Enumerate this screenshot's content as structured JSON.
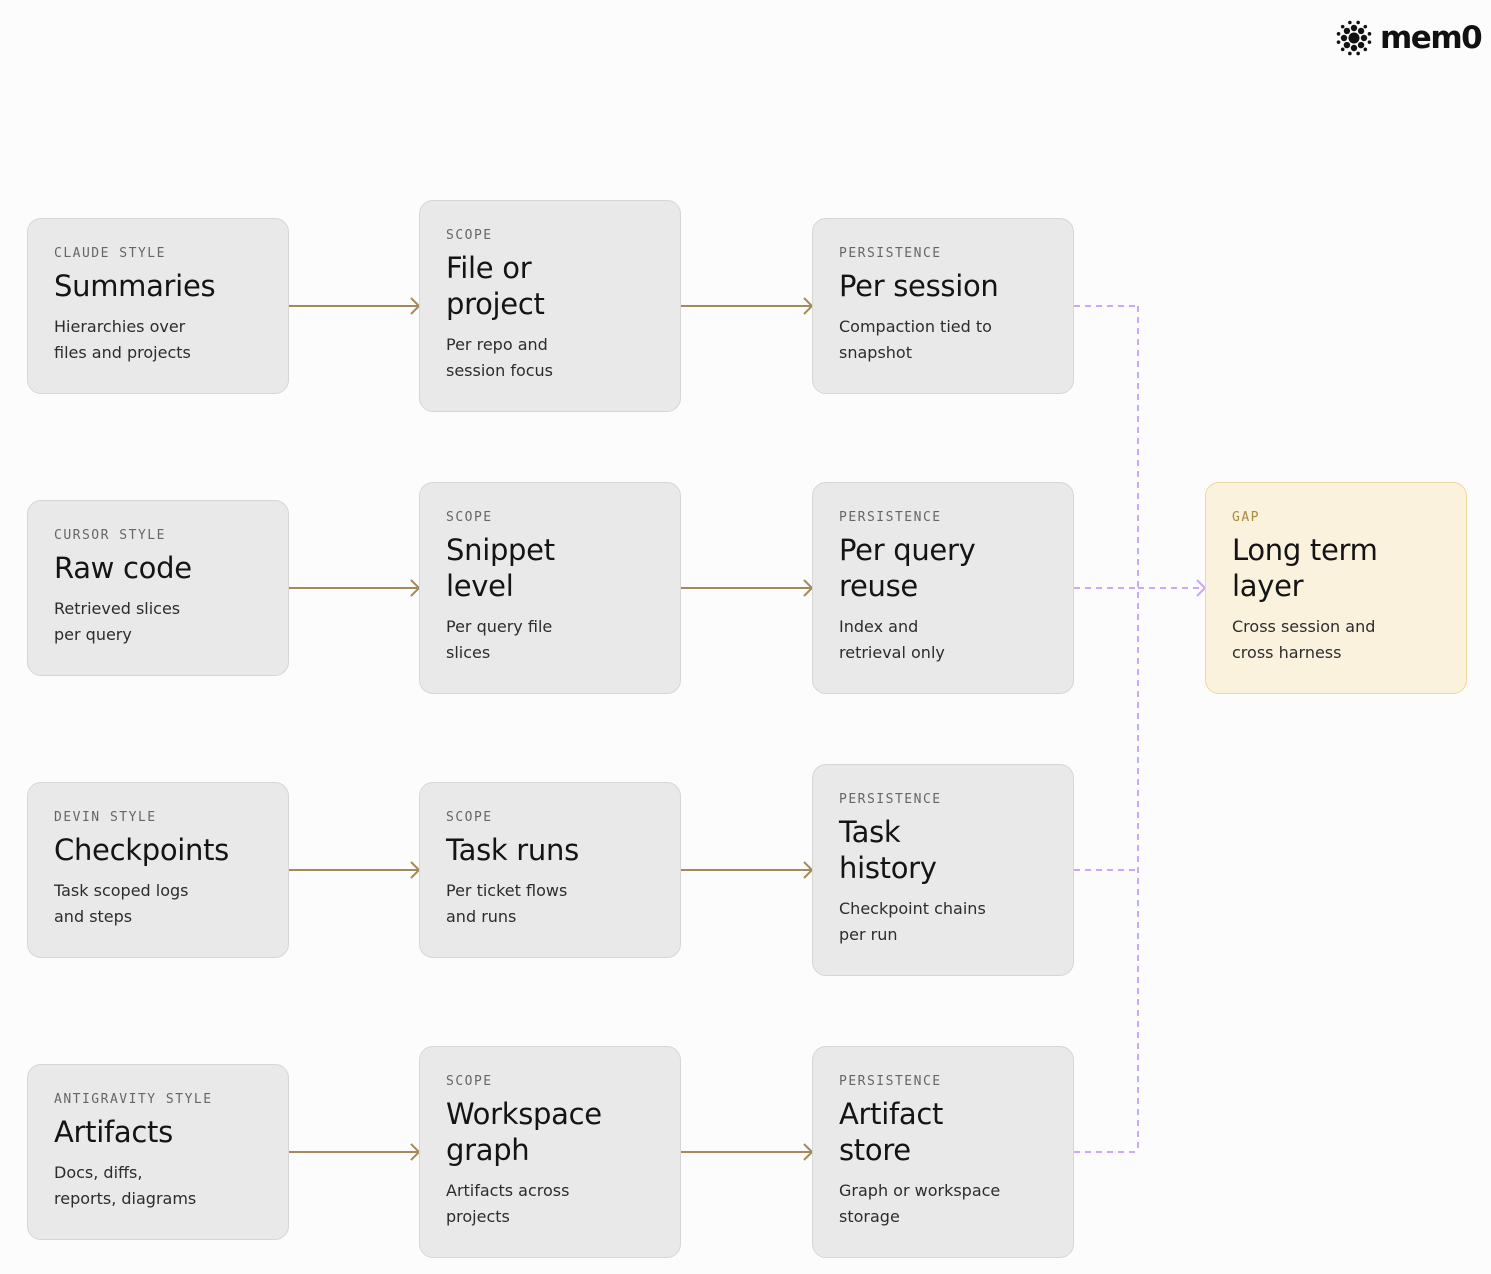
{
  "brand": {
    "wordmark": "mem0"
  },
  "colors": {
    "arrow": "#a48a5a",
    "dashed": "#c9a9f5",
    "card_bg": "#e9e9e9",
    "gap_bg": "#fbf2de",
    "gap_border": "#f1d89a"
  },
  "rows": [
    {
      "style": {
        "tag": "CLAUDE STYLE",
        "title": [
          "Summaries"
        ],
        "desc": [
          "Hierarchies over",
          "files and projects"
        ]
      },
      "scope": {
        "tag": "SCOPE",
        "title": [
          "File or",
          "project"
        ],
        "desc": [
          "Per repo and",
          "session focus"
        ]
      },
      "persistence": {
        "tag": "PERSISTENCE",
        "title": [
          "Per session"
        ],
        "desc": [
          "Compaction tied to",
          "snapshot"
        ]
      }
    },
    {
      "style": {
        "tag": "CURSOR STYLE",
        "title": [
          "Raw code"
        ],
        "desc": [
          "Retrieved slices",
          "per query"
        ]
      },
      "scope": {
        "tag": "SCOPE",
        "title": [
          "Snippet",
          "level"
        ],
        "desc": [
          "Per query file",
          "slices"
        ]
      },
      "persistence": {
        "tag": "PERSISTENCE",
        "title": [
          "Per query",
          "reuse"
        ],
        "desc": [
          "Index and",
          "retrieval only"
        ]
      }
    },
    {
      "style": {
        "tag": "DEVIN STYLE",
        "title": [
          "Checkpoints"
        ],
        "desc": [
          "Task scoped logs",
          "and steps"
        ]
      },
      "scope": {
        "tag": "SCOPE",
        "title": [
          "Task runs"
        ],
        "desc": [
          "Per ticket flows",
          "and runs"
        ]
      },
      "persistence": {
        "tag": "PERSISTENCE",
        "title": [
          "Task",
          "history"
        ],
        "desc": [
          "Checkpoint chains",
          "per run"
        ]
      }
    },
    {
      "style": {
        "tag": "ANTIGRAVITY STYLE",
        "title": [
          "Artifacts"
        ],
        "desc": [
          "Docs, diffs,",
          "reports, diagrams"
        ]
      },
      "scope": {
        "tag": "SCOPE",
        "title": [
          "Workspace",
          "graph"
        ],
        "desc": [
          "Artifacts across",
          "projects"
        ]
      },
      "persistence": {
        "tag": "PERSISTENCE",
        "title": [
          "Artifact",
          "store"
        ],
        "desc": [
          "Graph or workspace",
          "storage"
        ]
      }
    }
  ],
  "gap": {
    "tag": "GAP",
    "title": [
      "Long term",
      "layer"
    ],
    "desc": [
      "Cross session and",
      "cross harness"
    ]
  }
}
